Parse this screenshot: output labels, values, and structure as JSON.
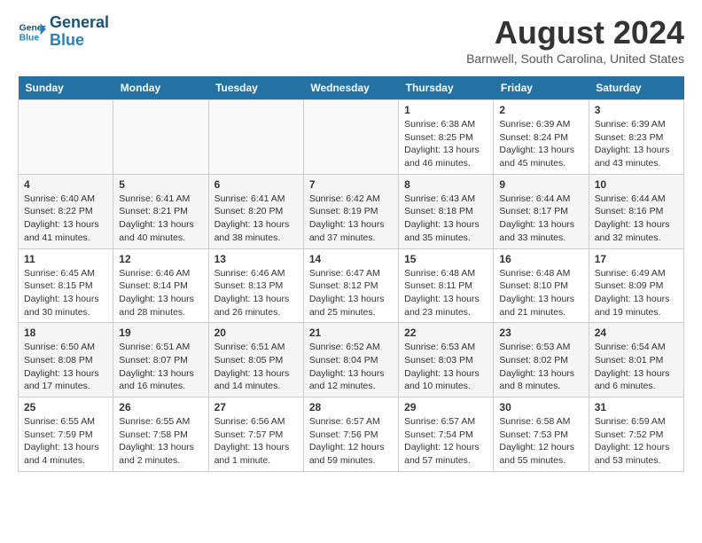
{
  "logo": {
    "line1": "General",
    "line2": "Blue"
  },
  "title": "August 2024",
  "subtitle": "Barnwell, South Carolina, United States",
  "days_of_week": [
    "Sunday",
    "Monday",
    "Tuesday",
    "Wednesday",
    "Thursday",
    "Friday",
    "Saturday"
  ],
  "weeks": [
    [
      {
        "day": "",
        "sunrise": "",
        "sunset": "",
        "daylight": ""
      },
      {
        "day": "",
        "sunrise": "",
        "sunset": "",
        "daylight": ""
      },
      {
        "day": "",
        "sunrise": "",
        "sunset": "",
        "daylight": ""
      },
      {
        "day": "",
        "sunrise": "",
        "sunset": "",
        "daylight": ""
      },
      {
        "day": "1",
        "sunrise": "Sunrise: 6:38 AM",
        "sunset": "Sunset: 8:25 PM",
        "daylight": "Daylight: 13 hours and 46 minutes."
      },
      {
        "day": "2",
        "sunrise": "Sunrise: 6:39 AM",
        "sunset": "Sunset: 8:24 PM",
        "daylight": "Daylight: 13 hours and 45 minutes."
      },
      {
        "day": "3",
        "sunrise": "Sunrise: 6:39 AM",
        "sunset": "Sunset: 8:23 PM",
        "daylight": "Daylight: 13 hours and 43 minutes."
      }
    ],
    [
      {
        "day": "4",
        "sunrise": "Sunrise: 6:40 AM",
        "sunset": "Sunset: 8:22 PM",
        "daylight": "Daylight: 13 hours and 41 minutes."
      },
      {
        "day": "5",
        "sunrise": "Sunrise: 6:41 AM",
        "sunset": "Sunset: 8:21 PM",
        "daylight": "Daylight: 13 hours and 40 minutes."
      },
      {
        "day": "6",
        "sunrise": "Sunrise: 6:41 AM",
        "sunset": "Sunset: 8:20 PM",
        "daylight": "Daylight: 13 hours and 38 minutes."
      },
      {
        "day": "7",
        "sunrise": "Sunrise: 6:42 AM",
        "sunset": "Sunset: 8:19 PM",
        "daylight": "Daylight: 13 hours and 37 minutes."
      },
      {
        "day": "8",
        "sunrise": "Sunrise: 6:43 AM",
        "sunset": "Sunset: 8:18 PM",
        "daylight": "Daylight: 13 hours and 35 minutes."
      },
      {
        "day": "9",
        "sunrise": "Sunrise: 6:44 AM",
        "sunset": "Sunset: 8:17 PM",
        "daylight": "Daylight: 13 hours and 33 minutes."
      },
      {
        "day": "10",
        "sunrise": "Sunrise: 6:44 AM",
        "sunset": "Sunset: 8:16 PM",
        "daylight": "Daylight: 13 hours and 32 minutes."
      }
    ],
    [
      {
        "day": "11",
        "sunrise": "Sunrise: 6:45 AM",
        "sunset": "Sunset: 8:15 PM",
        "daylight": "Daylight: 13 hours and 30 minutes."
      },
      {
        "day": "12",
        "sunrise": "Sunrise: 6:46 AM",
        "sunset": "Sunset: 8:14 PM",
        "daylight": "Daylight: 13 hours and 28 minutes."
      },
      {
        "day": "13",
        "sunrise": "Sunrise: 6:46 AM",
        "sunset": "Sunset: 8:13 PM",
        "daylight": "Daylight: 13 hours and 26 minutes."
      },
      {
        "day": "14",
        "sunrise": "Sunrise: 6:47 AM",
        "sunset": "Sunset: 8:12 PM",
        "daylight": "Daylight: 13 hours and 25 minutes."
      },
      {
        "day": "15",
        "sunrise": "Sunrise: 6:48 AM",
        "sunset": "Sunset: 8:11 PM",
        "daylight": "Daylight: 13 hours and 23 minutes."
      },
      {
        "day": "16",
        "sunrise": "Sunrise: 6:48 AM",
        "sunset": "Sunset: 8:10 PM",
        "daylight": "Daylight: 13 hours and 21 minutes."
      },
      {
        "day": "17",
        "sunrise": "Sunrise: 6:49 AM",
        "sunset": "Sunset: 8:09 PM",
        "daylight": "Daylight: 13 hours and 19 minutes."
      }
    ],
    [
      {
        "day": "18",
        "sunrise": "Sunrise: 6:50 AM",
        "sunset": "Sunset: 8:08 PM",
        "daylight": "Daylight: 13 hours and 17 minutes."
      },
      {
        "day": "19",
        "sunrise": "Sunrise: 6:51 AM",
        "sunset": "Sunset: 8:07 PM",
        "daylight": "Daylight: 13 hours and 16 minutes."
      },
      {
        "day": "20",
        "sunrise": "Sunrise: 6:51 AM",
        "sunset": "Sunset: 8:05 PM",
        "daylight": "Daylight: 13 hours and 14 minutes."
      },
      {
        "day": "21",
        "sunrise": "Sunrise: 6:52 AM",
        "sunset": "Sunset: 8:04 PM",
        "daylight": "Daylight: 13 hours and 12 minutes."
      },
      {
        "day": "22",
        "sunrise": "Sunrise: 6:53 AM",
        "sunset": "Sunset: 8:03 PM",
        "daylight": "Daylight: 13 hours and 10 minutes."
      },
      {
        "day": "23",
        "sunrise": "Sunrise: 6:53 AM",
        "sunset": "Sunset: 8:02 PM",
        "daylight": "Daylight: 13 hours and 8 minutes."
      },
      {
        "day": "24",
        "sunrise": "Sunrise: 6:54 AM",
        "sunset": "Sunset: 8:01 PM",
        "daylight": "Daylight: 13 hours and 6 minutes."
      }
    ],
    [
      {
        "day": "25",
        "sunrise": "Sunrise: 6:55 AM",
        "sunset": "Sunset: 7:59 PM",
        "daylight": "Daylight: 13 hours and 4 minutes."
      },
      {
        "day": "26",
        "sunrise": "Sunrise: 6:55 AM",
        "sunset": "Sunset: 7:58 PM",
        "daylight": "Daylight: 13 hours and 2 minutes."
      },
      {
        "day": "27",
        "sunrise": "Sunrise: 6:56 AM",
        "sunset": "Sunset: 7:57 PM",
        "daylight": "Daylight: 13 hours and 1 minute."
      },
      {
        "day": "28",
        "sunrise": "Sunrise: 6:57 AM",
        "sunset": "Sunset: 7:56 PM",
        "daylight": "Daylight: 12 hours and 59 minutes."
      },
      {
        "day": "29",
        "sunrise": "Sunrise: 6:57 AM",
        "sunset": "Sunset: 7:54 PM",
        "daylight": "Daylight: 12 hours and 57 minutes."
      },
      {
        "day": "30",
        "sunrise": "Sunrise: 6:58 AM",
        "sunset": "Sunset: 7:53 PM",
        "daylight": "Daylight: 12 hours and 55 minutes."
      },
      {
        "day": "31",
        "sunrise": "Sunrise: 6:59 AM",
        "sunset": "Sunset: 7:52 PM",
        "daylight": "Daylight: 12 hours and 53 minutes."
      }
    ]
  ]
}
